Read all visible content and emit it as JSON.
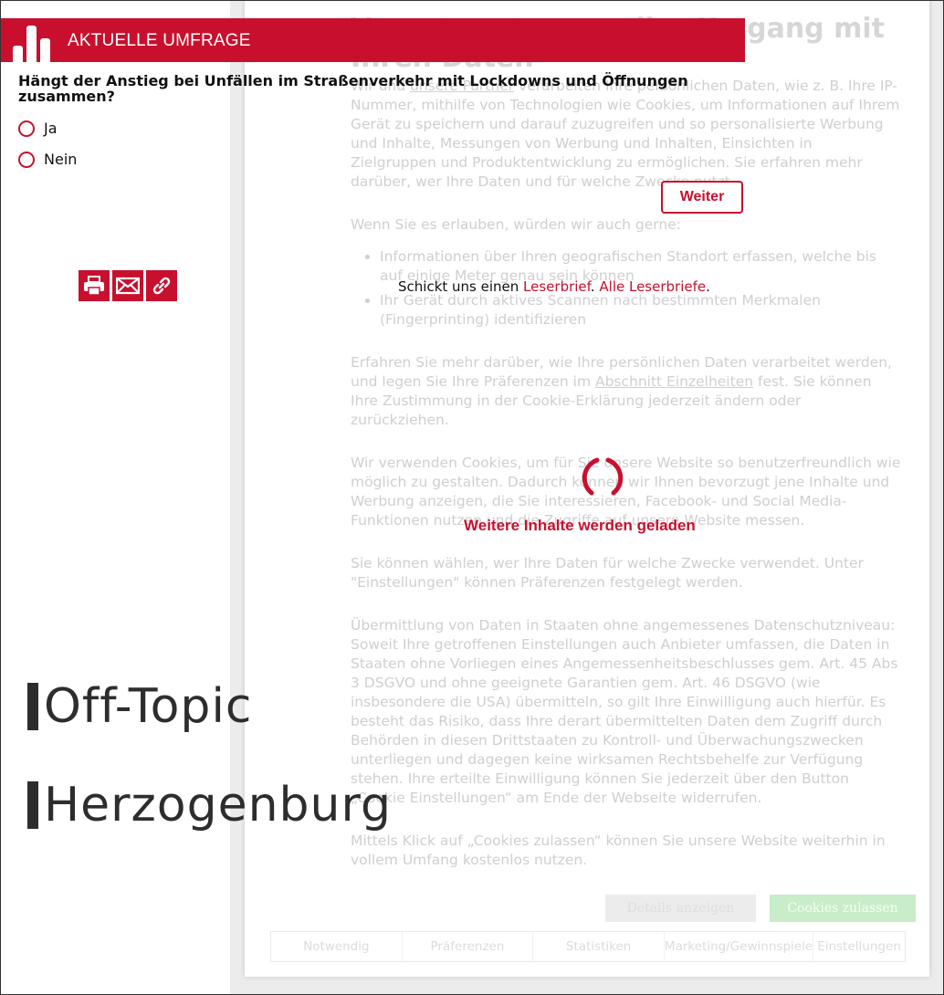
{
  "survey": {
    "header": "AKTUELLE UMFRAGE",
    "question": "Hängt der Anstieg bei Unfällen im Straßenverkehr mit Lockdowns und Öffnungen zusammen?",
    "options": [
      "Ja",
      "Nein"
    ],
    "submit_label": "Weiter"
  },
  "share": {
    "icons": [
      "print-icon",
      "mail-icon",
      "link-icon"
    ]
  },
  "letter": {
    "prefix": "Schickt uns einen ",
    "link1": "Leserbrief",
    "sep": ". ",
    "link2": "Alle Leserbriefe",
    "suffix": "."
  },
  "loading": {
    "text": "Weitere Inhalte werden geladen"
  },
  "topics": [
    "Off-Topic",
    "Herzogenburg"
  ],
  "cookie": {
    "title": "Verantwortungsvoller Umgang mit Ihren Daten",
    "p1_a": "Wir und ",
    "p1_link": "unsere Partner",
    "p1_b": " verarbeiten Ihre persönlichen Daten, wie z. B. Ihre IP-Nummer, mithilfe von Technologien wie Cookies, um Informationen auf Ihrem Gerät zu speichern und darauf zuzugreifen und so personalisierte Werbung und Inhalte, Messungen von Werbung und Inhalten, Einsichten in Zielgruppen und Produktentwicklung zu ermöglichen. Sie erfahren mehr darüber, wer Ihre Daten und für welche Zwecke nutzt.",
    "p2": "Wenn Sie es erlauben, würden wir auch gerne:",
    "li1": "Informationen über Ihren geografischen Standort erfassen, welche bis auf einige Meter genau sein können",
    "li2": "Ihr Gerät durch aktives Scannen nach bestimmten Merkmalen (Fingerprinting) identifizieren",
    "p3_a": "Erfahren Sie mehr darüber, wie Ihre persönlichen Daten verarbeitet werden, und legen Sie Ihre Präferenzen im ",
    "p3_link": "Abschnitt Einzelheiten",
    "p3_b": " fest. Sie können Ihre Zustimmung in der Cookie-Erklärung jederzeit ändern oder zurückziehen.",
    "p4": "Wir verwenden Cookies, um für Sie unsere Website so benutzerfreundlich wie möglich zu gestalten. Dadurch können wir Ihnen bevorzugt jene Inhalte und Werbung anzeigen, die Sie interessieren, Facebook- und Social Media-Funktionen nutzen und die Zugriffe auf unsere Website messen.",
    "p5": "Sie können wählen, wer Ihre Daten für welche Zwecke verwendet. Unter \"Einstellungen\" können Präferenzen festgelegt werden.",
    "p6": "Übermittlung von Daten in Staaten ohne angemessenes Datenschutzniveau: Soweit Ihre getroffenen Einstellungen auch Anbieter umfassen, die Daten in Staaten ohne Vorliegen eines Angemessenheitsbeschlusses gem. Art. 45 Abs 3 DSGVO und ohne geeignete Garantien gem. Art. 46 DSGVO (wie insbesondere die USA) übermitteln, so gilt Ihre Einwilligung auch hierfür. Es besteht das Risiko, dass Ihre derart übermittelten Daten dem Zugriff durch Behörden in diesen Drittstaaten zu Kontroll- und Überwachungszwecken unterliegen und dagegen keine wirksamen Rechtsbehelfe zur Verfügung stehen. Ihre erteilte Einwilligung können Sie jederzeit über den Button „Cookie Einstellungen“ am Ende der Webseite widerrufen.",
    "p7": "Mittels Klick auf „Cookies zulassen“ können Sie unsere Website weiterhin in vollem Umfang kostenlos nutzen.",
    "btn_details": "Details anzeigen",
    "btn_allow": "Cookies zulassen",
    "tabs": [
      "Notwendig",
      "Präferenzen",
      "Statistiken",
      "Marketing/Gewinnspiele",
      "Einstellungen"
    ]
  },
  "colors": {
    "accent": "#c8102e",
    "text": "#222222"
  }
}
